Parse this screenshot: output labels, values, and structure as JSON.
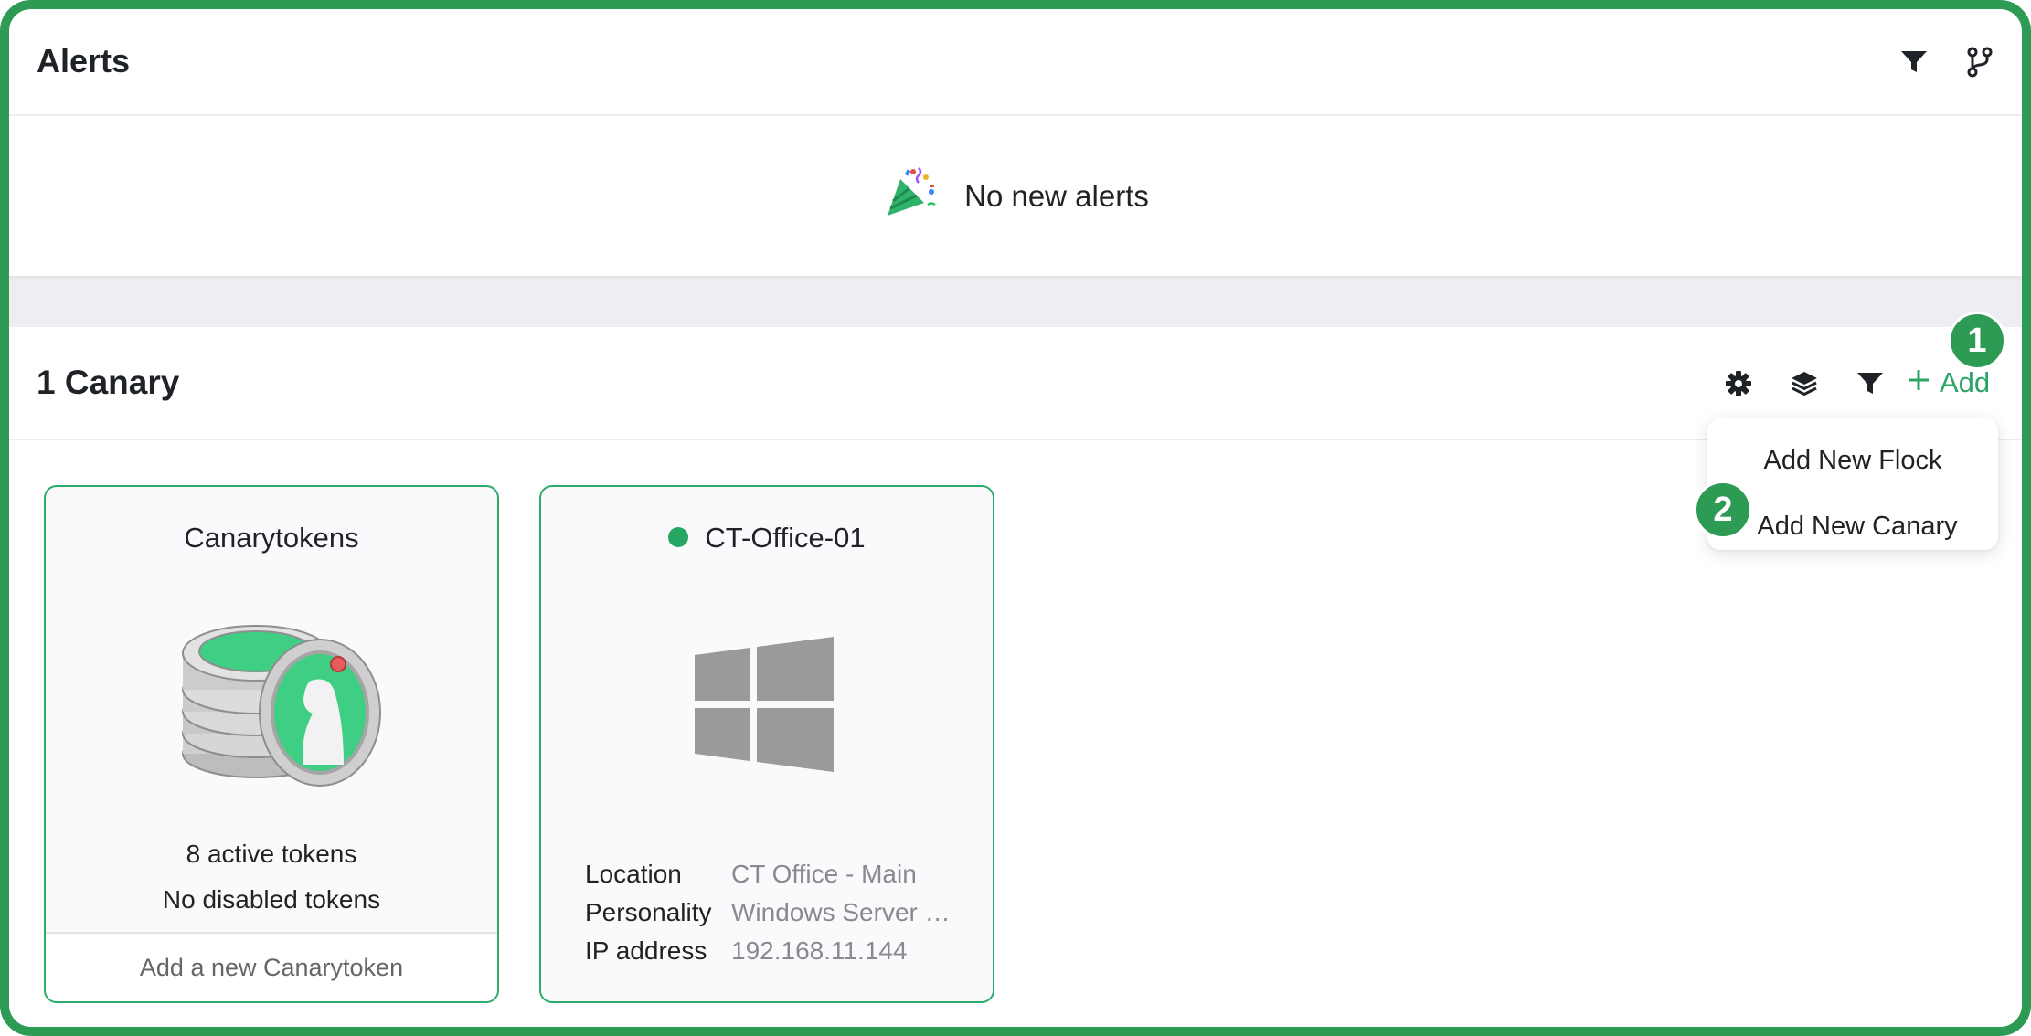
{
  "alerts": {
    "title": "Alerts",
    "empty_message": "No new alerts",
    "icons": [
      "filter-icon",
      "branch-icon",
      "party-popper-icon"
    ]
  },
  "canaries": {
    "title": "1 Canary",
    "add_label": "Add",
    "icons": [
      "gear-icon",
      "layers-icon",
      "filter-icon",
      "plus-icon"
    ],
    "dropdown": {
      "items": [
        {
          "label": "Add New Flock"
        },
        {
          "label": "Add New Canary"
        }
      ]
    },
    "step_badges": [
      "1",
      "2"
    ]
  },
  "cards": {
    "canarytokens": {
      "title": "Canarytokens",
      "active_tokens": "8 active tokens",
      "disabled_tokens": "No disabled tokens",
      "footer_action": "Add a new Canarytoken",
      "icon": "token-coins-icon"
    },
    "device": {
      "name": "CT-Office-01",
      "status_color": "#27a663",
      "icon": "windows-logo-icon",
      "fields": [
        {
          "label": "Location",
          "value": "CT Office - Main"
        },
        {
          "label": "Personality",
          "value": "Windows Server …"
        },
        {
          "label": "IP address",
          "value": "192.168.11.144"
        }
      ]
    }
  },
  "colors": {
    "accent": "#2e9b55",
    "link_green": "#2aa566",
    "band_gray": "#eceef1"
  }
}
